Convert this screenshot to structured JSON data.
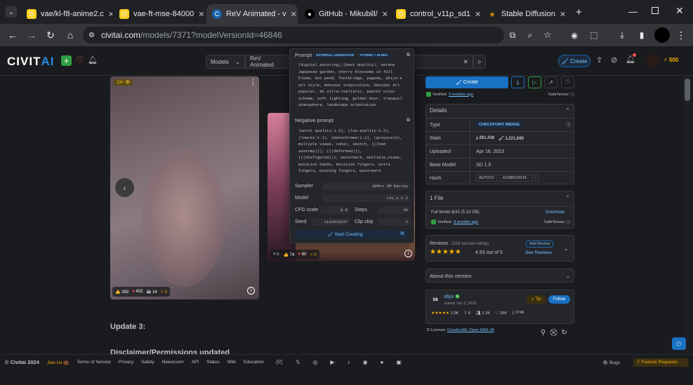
{
  "browser": {
    "tabs": [
      {
        "title": "vae/kl-f8-anime2.c",
        "icon": "huggingface-icon"
      },
      {
        "title": "vae-ft-mse-84000",
        "icon": "huggingface-icon"
      },
      {
        "title": "ReV Animated - v",
        "icon": "civitai-icon",
        "active": true
      },
      {
        "title": "GitHub - Mikubill/",
        "icon": "github-icon"
      },
      {
        "title": "control_v11p_sd1",
        "icon": "huggingface-icon"
      },
      {
        "title": "Stable Diffusion",
        "icon": "layers-icon"
      }
    ],
    "url_host": "civitai.com",
    "url_path": "/models/7371?modelVersionId=46846"
  },
  "header": {
    "logo_a": "CIVIT",
    "logo_b": "AI",
    "search_category": "Models",
    "search_value": "ReV Animated",
    "create_label": "Create",
    "buzz_count": "500"
  },
  "image_card": {
    "badge": "13+",
    "reactions": {
      "like": "283",
      "heart": "402",
      "laugh": "14",
      "buzz": "0"
    }
  },
  "image_card2": {
    "reactions": {
      "like": "74",
      "heart": "80",
      "buzz": "0"
    }
  },
  "popup": {
    "prompt_label": "Prompt",
    "tag1": "EXTERNAL GENERATOR",
    "tag2": "TXT2IMG + HI-RES",
    "prompt_lines": [
      "(digital painting),(best quality), serene",
      "Japanese garden, cherry blossoms in full",
      "bloom, koi pond, footbridge, pagoda, Ukiyo-e",
      "art style, Hokusai inspiration, Deviant Art",
      "popular, 8k ultra-realistic, pastel color",
      "scheme, soft lighting, golden hour, tranquil",
      "atmosphere, landscape orientation"
    ],
    "neg_label": "Negative prompt",
    "neg_lines": [
      "(worst quality:1.2), (low quality:1.2),",
      "(lowres:1.1), (monochrome:1.1), (greyscale),",
      "multiple views, comic, sketch, (((bad",
      "anatomy))), (((deformed))),",
      "(((disfigured))), watermark, multiple_views,",
      "mutation hands, mutation fingers, extra",
      "fingers, missing fingers, watermark"
    ],
    "sampler_k": "Sampler",
    "sampler_v": "DPM++ 2M Karras",
    "model_k": "Model",
    "model_v": "rev_1.2.2",
    "cfg_k": "CFG scale",
    "cfg_v": "8.5",
    "steps_k": "Steps",
    "steps_v": "30",
    "seed_k": "Seed",
    "seed_v": "1132013237",
    "clip_k": "Clip skip",
    "clip_v": "2",
    "start_label": "Start Creating"
  },
  "sidebar": {
    "create_label": "Create",
    "verified_text": "Verified:",
    "verified_when": "9 months ago",
    "safetensor": "SafeTensor",
    "details_label": "Details",
    "rows": {
      "type_k": "Type",
      "type_v": "CHECKPOINT MERGE",
      "stats_k": "Stats",
      "stats_dl": "281,438",
      "stats_gen": "1,221,695",
      "uploaded_k": "Uploaded",
      "uploaded_v": "Apr 16, 2023",
      "base_k": "Base Model",
      "base_v": "SD 1.5",
      "hash_k": "Hash",
      "hash_type": "AUTOV2",
      "hash_v": "4199BCDD14"
    },
    "file_label": "1 File",
    "file_name": "Full Model fp32 (5.13 GB)",
    "download_label": "Download",
    "file_verified": "Verified:",
    "file_verified_when": "9 months ago",
    "file_safetensor": "SafeTensor",
    "reviews_label": "Reviews",
    "ratings_count": "2154 version ratings",
    "add_review": "Add Review",
    "rating_text": "4.93 out of 5",
    "see_reviews": "See Reviews",
    "about_label": "About this version",
    "creator_initials": "S6",
    "creator_name": "s6yx",
    "creator_joined": "Joined Jan 3, 2023",
    "tip_label": "Tip",
    "follow_label": "Follow",
    "creator_stats": {
      "rating": "2.9K",
      "uploads": "6",
      "followers": "2.2K",
      "likes": "35K",
      "downloads": "374K"
    },
    "license_text": "License:",
    "license_link": "CreativeML Open RAIL-M"
  },
  "main": {
    "update_heading": "Update 3:",
    "disclaimer": "Disclaimer/Permissions updated"
  },
  "footer": {
    "copyright": "© Civitai 2024",
    "join_us": "Join Us 💼",
    "links": [
      "Terms of Service",
      "Privacy",
      "Safety",
      "Newsroom",
      "API",
      "Status",
      "Wiki",
      "Education"
    ],
    "bugs": "Bugs",
    "feature_requests": "Feature Requests"
  },
  "colors": {
    "accent": "#228be6",
    "buzz": "#fab005",
    "heart": "#fa5252",
    "star": "#fab005",
    "bg": "#1a1b1e"
  }
}
